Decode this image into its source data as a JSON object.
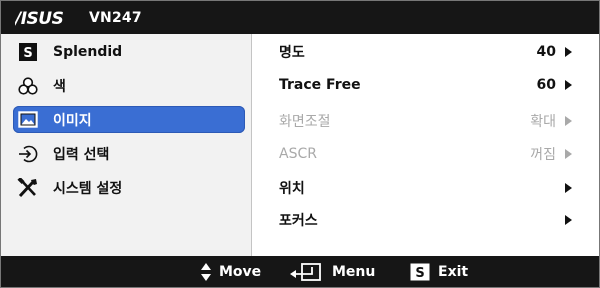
{
  "header": {
    "brand": "ASUS",
    "model": "VN247"
  },
  "sidebar": {
    "items": [
      {
        "label": "Splendid",
        "icon": "splendid-s-icon",
        "selected": false
      },
      {
        "label": "색",
        "icon": "color-icon",
        "selected": false
      },
      {
        "label": "이미지",
        "icon": "image-icon",
        "selected": true
      },
      {
        "label": "입력 선택",
        "icon": "input-select-icon",
        "selected": false
      },
      {
        "label": "시스템 설정",
        "icon": "tools-icon",
        "selected": false
      }
    ]
  },
  "settings": {
    "rows": [
      {
        "label": "명도",
        "value": "40",
        "enabled": true
      },
      {
        "label": "Trace Free",
        "value": "60",
        "enabled": true
      },
      {
        "label": "화면조절",
        "value": "확대",
        "enabled": false
      },
      {
        "label": "ASCR",
        "value": "꺼짐",
        "enabled": false
      },
      {
        "label": "위치",
        "value": "",
        "enabled": true
      },
      {
        "label": "포커스",
        "value": "",
        "enabled": true
      }
    ]
  },
  "footer": {
    "move_label": "Move",
    "menu_label": "Menu",
    "exit_label": "Exit"
  },
  "colors": {
    "bar_bg": "#161616",
    "selected_bg": "#3a6ed3",
    "sidebar_bg": "#f2f2f2",
    "disabled_text": "#a9a9a9"
  }
}
